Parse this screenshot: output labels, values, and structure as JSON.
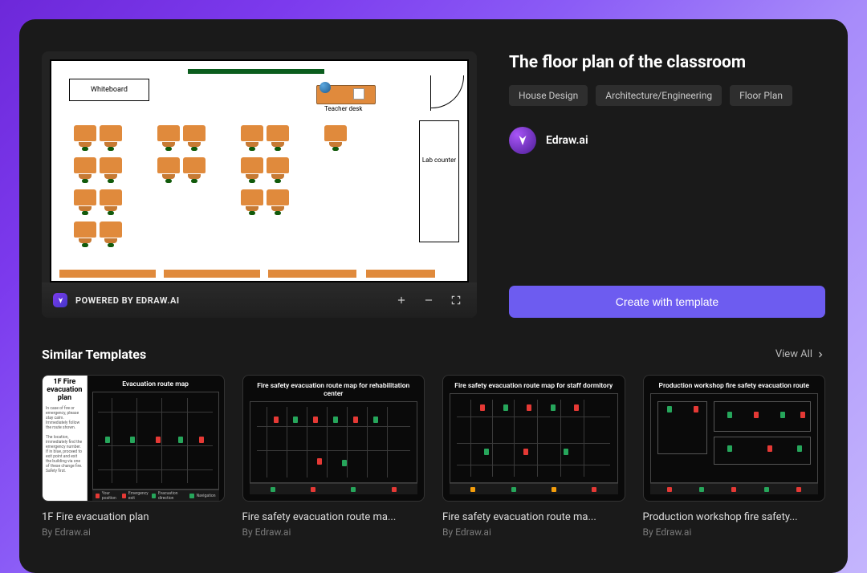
{
  "detail": {
    "title": "The floor plan of the classroom",
    "tags": [
      "House Design",
      "Architecture/Engineering",
      "Floor Plan"
    ],
    "author": "Edraw.ai",
    "create_button": "Create with template"
  },
  "viewer": {
    "powered_by": "POWERED BY EDRAW.AI"
  },
  "floorplan": {
    "whiteboard_label": "Whiteboard",
    "teacher_desk_label": "Teacher desk",
    "lab_counter_label": "Lab counter"
  },
  "similar": {
    "heading": "Similar Templates",
    "view_all": "View All",
    "templates": [
      {
        "title": "1F Fire evacuation plan",
        "author": "By Edraw.ai",
        "thumb_left_title": "1F Fire evacuation plan",
        "thumb_title": "Evacuation route map"
      },
      {
        "title": "Fire safety evacuation route ma...",
        "author": "By Edraw.ai",
        "thumb_title": "Fire safety evacuation route map for rehabilitation center"
      },
      {
        "title": "Fire safety evacuation route ma...",
        "author": "By Edraw.ai",
        "thumb_title": "Fire safety evacuation route map for staff dormitory"
      },
      {
        "title": "Production workshop fire safety...",
        "author": "By Edraw.ai",
        "thumb_title": "Production workshop fire safety evacuation route"
      }
    ]
  }
}
